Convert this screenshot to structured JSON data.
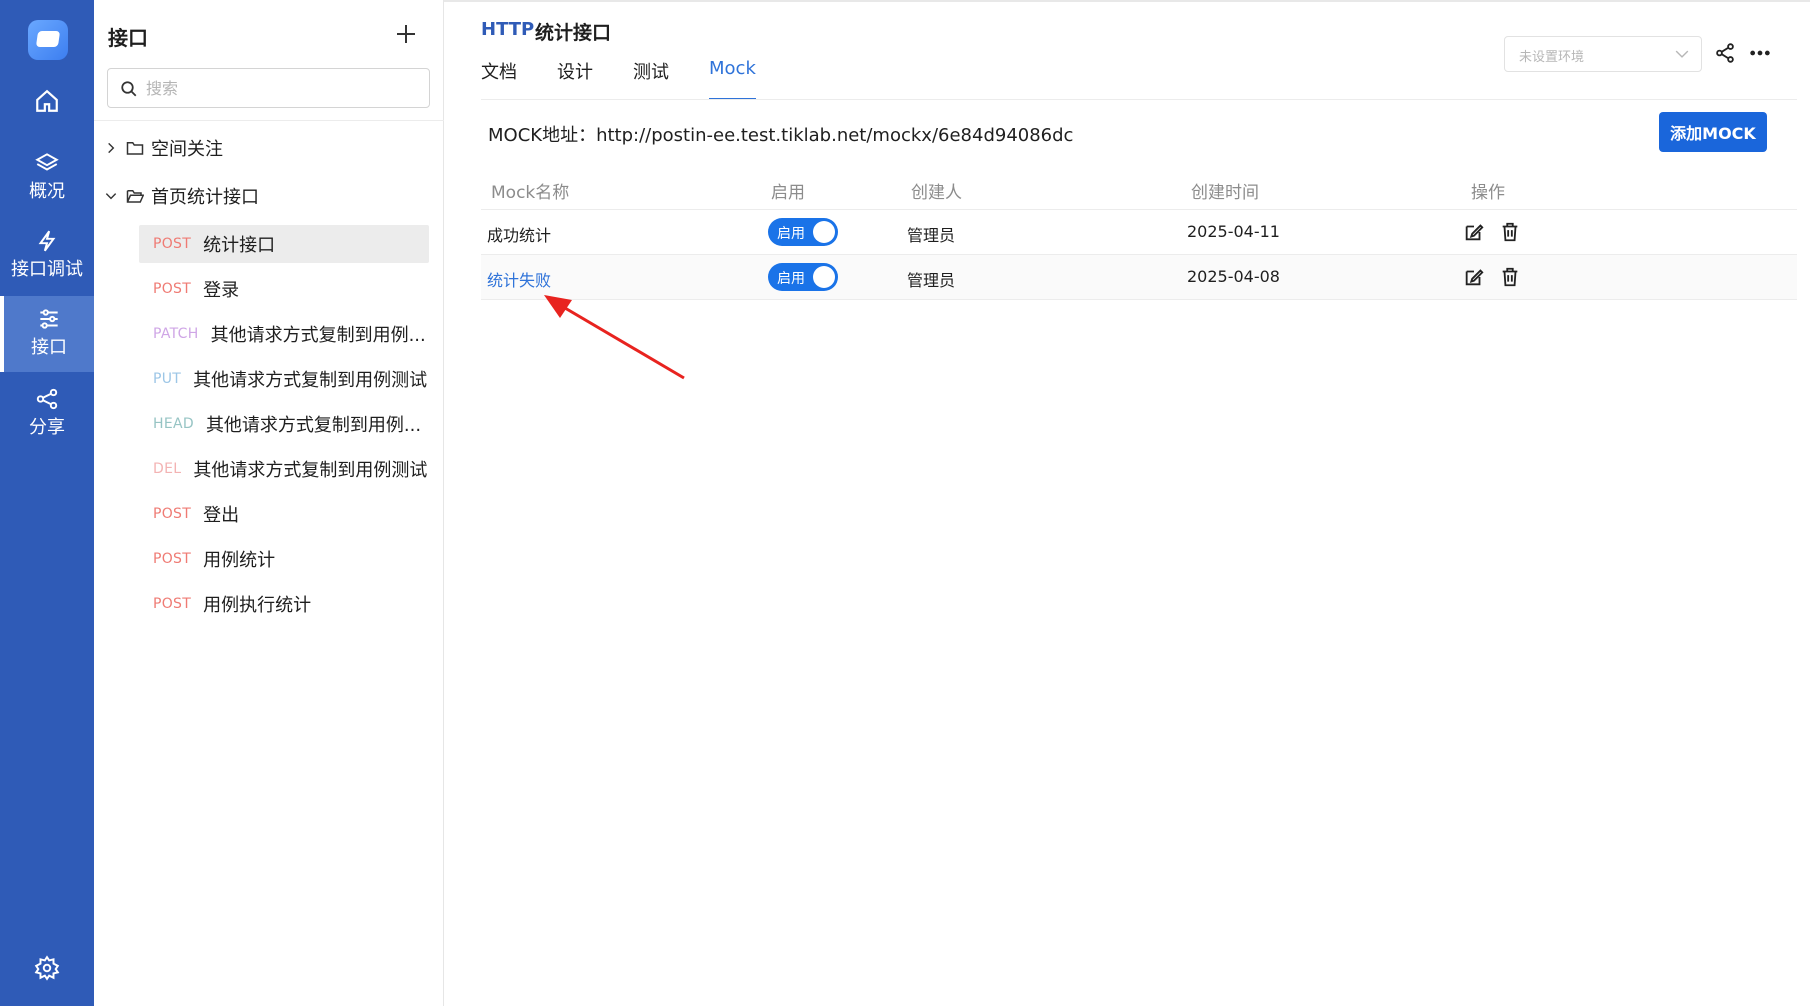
{
  "rail": {
    "items": [
      {
        "label": "概况",
        "icon": "layers-icon"
      },
      {
        "label": "接口调试",
        "icon": "bolt-icon"
      },
      {
        "label": "接口",
        "icon": "sliders-icon"
      },
      {
        "label": "分享",
        "icon": "share-icon"
      }
    ]
  },
  "tree": {
    "title": "接口",
    "search_placeholder": "搜索",
    "folders": [
      {
        "name": "空间关注",
        "expanded": false
      },
      {
        "name": "首页统计接口",
        "expanded": true
      }
    ],
    "apis": [
      {
        "method": "POST",
        "name": "统计接口",
        "selected": true
      },
      {
        "method": "POST",
        "name": "登录"
      },
      {
        "method": "PATCH",
        "name": "其他请求方式复制到用例..."
      },
      {
        "method": "PUT",
        "name": "其他请求方式复制到用例测试"
      },
      {
        "method": "HEAD",
        "name": "其他请求方式复制到用例..."
      },
      {
        "method": "DEL",
        "name": "其他请求方式复制到用例测试"
      },
      {
        "method": "POST",
        "name": "登出"
      },
      {
        "method": "POST",
        "name": "用例统计"
      },
      {
        "method": "POST",
        "name": "用例执行统计"
      }
    ],
    "method_colors": {
      "POST": "#ef7b74",
      "PATCH": "#cfa6e6",
      "PUT": "#9cc6e6",
      "HEAD": "#97c4c4",
      "DEL": "#f3b3b3"
    }
  },
  "header": {
    "protocol": "HTTP",
    "api_name": "统计接口",
    "tabs": [
      "文档",
      "设计",
      "测试",
      "Mock"
    ],
    "active_tab": "Mock",
    "env_placeholder": "未设置环境"
  },
  "mock": {
    "url_label": "MOCK地址：",
    "url": "http://postin-ee.test.tiklab.net/mockx/6e84d94086dc",
    "add_button": "添加MOCK",
    "columns": [
      "Mock名称",
      "启用",
      "创建人",
      "创建时间",
      "操作"
    ],
    "rows": [
      {
        "name": "成功统计",
        "enabled_label": "启用",
        "creator": "管理员",
        "created": "2025-04-11"
      },
      {
        "name": "统计失败",
        "enabled_label": "启用",
        "creator": "管理员",
        "created": "2025-04-08"
      }
    ]
  },
  "colors": {
    "rail": "#2f5bb7",
    "accent": "#2f73d9",
    "button": "#1a66db",
    "arrow": "#e8231f"
  }
}
